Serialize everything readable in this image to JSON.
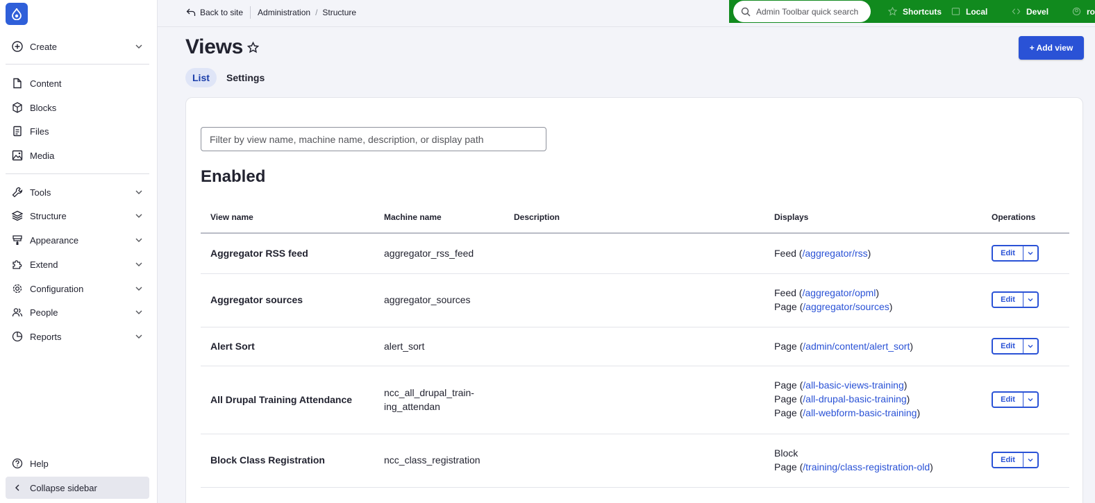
{
  "sidebar": {
    "create": "Create",
    "content": "Content",
    "blocks": "Blocks",
    "files": "Files",
    "media": "Media",
    "tools": "Tools",
    "structure": "Structure",
    "appearance": "Appearance",
    "extend": "Extend",
    "configuration": "Configuration",
    "people": "People",
    "reports": "Reports",
    "help": "Help",
    "collapse": "Collapse sidebar"
  },
  "breadcrumb": {
    "back": "Back to site",
    "items": [
      "Administration",
      "Structure"
    ]
  },
  "admin_toolbar": {
    "search_placeholder": "Admin Toolbar quick search",
    "shortcuts": "Shortcuts",
    "local": "Local",
    "devel": "Devel",
    "user": "root",
    "bg_color": "#118a1e"
  },
  "page": {
    "title": "Views",
    "add_button": "+ Add view",
    "tabs": [
      "List",
      "Settings"
    ]
  },
  "filter": {
    "placeholder": "Filter by view name, machine name, description, or display path"
  },
  "section": "Enabled",
  "table": {
    "headers": [
      "View name",
      "Machine name",
      "Description",
      "Displays",
      "Operations"
    ],
    "rows": [
      {
        "name": "Aggregator RSS feed",
        "machine": "aggregator_rss_feed",
        "displays": [
          {
            "type": "Feed",
            "path": "/aggregator/rss"
          }
        ]
      },
      {
        "name": "Aggregator sources",
        "machine": "aggregator_sources",
        "displays": [
          {
            "type": "Feed",
            "path": "/aggregator/opml"
          },
          {
            "type": "Page",
            "path": "/aggregator/sources"
          }
        ]
      },
      {
        "name": "Alert Sort",
        "machine": "alert_sort",
        "displays": [
          {
            "type": "Page",
            "path": "/admin/content/alert_sort"
          }
        ]
      },
      {
        "name": "All Drupal Training Attendance",
        "machine_lines": [
          "ncc_all_drupal_train-",
          "ing_attendan"
        ],
        "displays": [
          {
            "type": "Page",
            "path": "/all-basic-views-training"
          },
          {
            "type": "Page",
            "path": "/all-drupal-basic-training"
          },
          {
            "type": "Page",
            "path": "/all-webform-basic-training"
          }
        ]
      },
      {
        "name": "Block Class Registration",
        "machine": "ncc_class_registration",
        "displays": [
          {
            "type": "Block"
          },
          {
            "type": "Page",
            "path": "/training/class-registration-old"
          }
        ]
      }
    ],
    "edit_label": "Edit"
  },
  "colors": {
    "accent": "#2a52d6",
    "background": "#f3f4f9"
  }
}
